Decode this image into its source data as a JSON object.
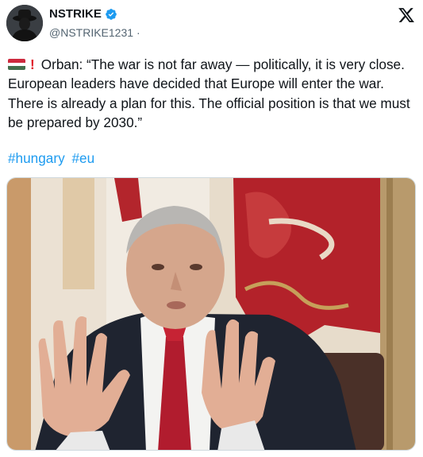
{
  "author": {
    "display_name": "NSTRIKE",
    "handle": "@NSTRIKE1231",
    "separator": "·",
    "verified": true
  },
  "icons": {
    "brand": "x-logo-icon",
    "verified": "verified-badge-icon",
    "flag": "hungary-flag-emoji",
    "exclamation": "red-exclamation-emoji"
  },
  "tweet": {
    "flag_emoji": "🇭🇺",
    "exclamation_emoji": "❗",
    "text": "Orban: “The war is not far away — politically, it is very close. European leaders have decided that Europe will enter the war. There is already a plan for this. The official position is that we must be prepared by 2030.”",
    "hashtags": [
      "#hungary",
      "#eu"
    ]
  },
  "colors": {
    "link": "#1d9bf0",
    "verified": "#1d9bf0",
    "text": "#0f1419",
    "secondary": "#536471",
    "flag_red": "#cd2a3e",
    "flag_white": "#ffffff",
    "flag_green": "#436f4d"
  }
}
